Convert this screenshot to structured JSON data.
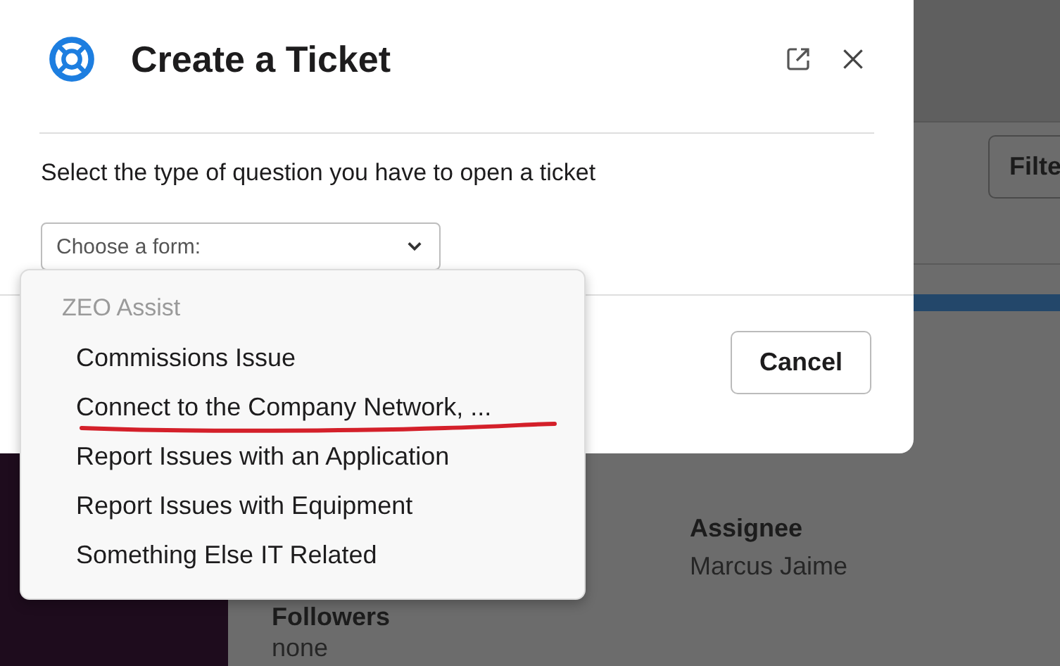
{
  "modal": {
    "title": "Create a Ticket",
    "prompt": "Select the type of question you have to open a ticket",
    "select": {
      "placeholder": "Choose a form:"
    },
    "cancel_button": "Cancel"
  },
  "dropdown": {
    "group": "ZEO Assist",
    "options": [
      {
        "label": "Commissions Issue",
        "selected": false,
        "underlined": false
      },
      {
        "label": "Connect to the Company Network, ...",
        "selected": false,
        "underlined": true
      },
      {
        "label": "Report Issues with an Application",
        "selected": false,
        "underlined": false
      },
      {
        "label": "Report Issues with Equipment",
        "selected": false,
        "underlined": false
      },
      {
        "label": "Something Else IT Related",
        "selected": false,
        "underlined": false
      }
    ]
  },
  "background": {
    "filter_button": "Filte",
    "assignee_label": "Assignee",
    "assignee_value": "Marcus Jaime",
    "followers_label": "Followers",
    "followers_value": "none"
  }
}
